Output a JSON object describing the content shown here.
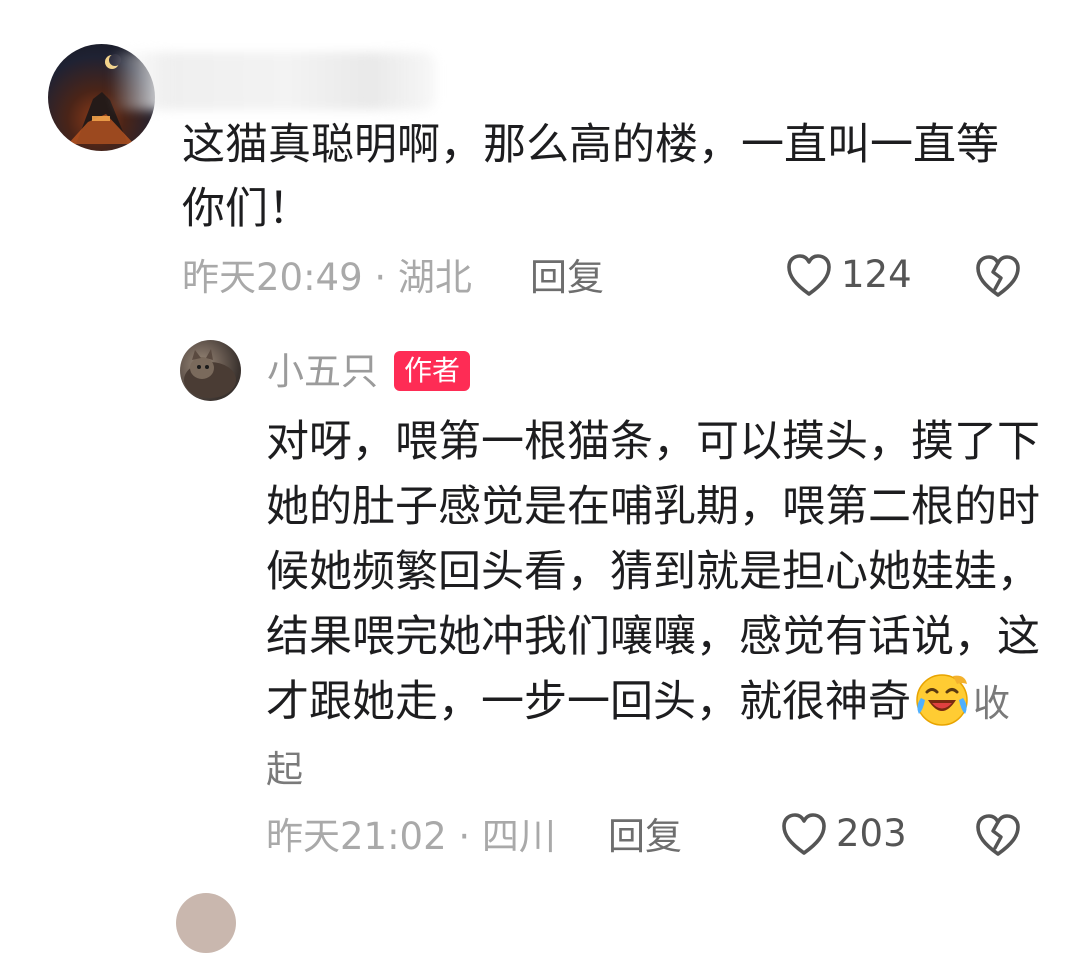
{
  "comment1": {
    "text": "这猫真聪明啊，那么高的楼，一直叫一直等你们！",
    "time_location": "昨天20:49 · 湖北",
    "reply_label": "回复",
    "likes": "124"
  },
  "comment2": {
    "username": "小五只",
    "badge": "作者",
    "text": "对呀，喂第一根猫条，可以摸头，摸了下她的肚子感觉是在哺乳期，喂第二根的时候她频繁回头看，猜到就是担心她娃娃，结果喂完她冲我们嚷嚷，感觉有话说，这才跟她走，一步一回头，就很神奇",
    "collapse_label": "收起",
    "time_location": "昨天21:02 · 四川",
    "reply_label": "回复",
    "likes": "203"
  },
  "icons": {
    "like": "heart-outline-icon",
    "dislike": "broken-heart-icon",
    "emoji": "laughing-crying-emoji-icon"
  },
  "colors": {
    "badge_bg": "#fe2c55",
    "meta_text": "#a9a9a9"
  }
}
